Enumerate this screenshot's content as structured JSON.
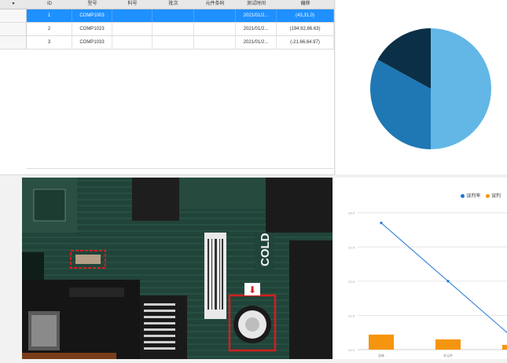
{
  "table": {
    "sort_glyph": "▾",
    "columns": [
      "ID",
      "型号",
      "料号",
      "批次",
      "元件条码",
      "测试时间",
      "偏移"
    ],
    "rows": [
      {
        "id": "1",
        "model": "COMP1003",
        "part": "",
        "batch": "",
        "barcode": "",
        "time": "2021/01/2...",
        "offset": "(43,31,0)",
        "selected": true
      },
      {
        "id": "2",
        "model": "COMP1023",
        "part": "",
        "batch": "",
        "barcode": "",
        "time": "2021/01/2...",
        "offset": "(194.92,86.63)",
        "selected": false
      },
      {
        "id": "3",
        "model": "COMP1033",
        "part": "",
        "batch": "",
        "barcode": "",
        "time": "2021/01/2...",
        "offset": "(-21.66,64.97)",
        "selected": false
      }
    ]
  },
  "pie_chart": {
    "type": "pie",
    "slices": [
      {
        "value": 50,
        "color": "#62b7e6"
      },
      {
        "value": 33,
        "color": "#1f78b4"
      },
      {
        "value": 17,
        "color": "#0b2f47"
      }
    ]
  },
  "photo": {
    "board_label": "COLD",
    "arrow_glyph": "⬇"
  },
  "chart_data": {
    "type": "bar",
    "legend": [
      {
        "name": "误判率",
        "color": "#1f77d4"
      },
      {
        "name": "误判",
        "color": "#f5950f"
      }
    ],
    "y_ticks": [
      "23.0",
      "22.5",
      "22.0",
      "21.5",
      "21.0"
    ],
    "categories": [
      "总体",
      "木元件",
      ""
    ],
    "line_series": {
      "name": "误判率",
      "values": [
        22.85,
        22.0,
        21.15
      ]
    },
    "bar_series": {
      "name": "误判",
      "values": [
        21.22,
        21.15,
        21.07
      ]
    },
    "ylim": [
      21.0,
      23.1
    ]
  }
}
